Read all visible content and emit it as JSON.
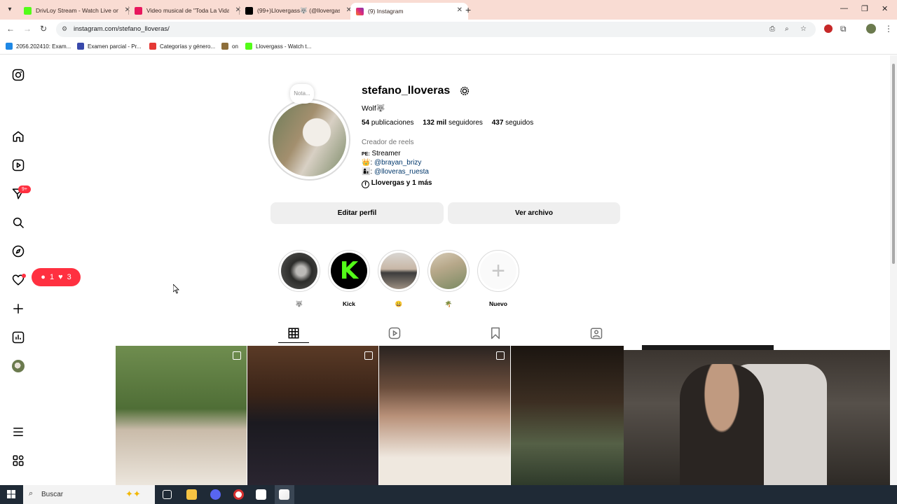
{
  "browser": {
    "tabs": [
      {
        "label": "DrivLoy Stream - Watch Live on",
        "favicon_color": "#53fc18"
      },
      {
        "label": "Video musical de \"Toda La Vida",
        "favicon_color": "#e8175d"
      },
      {
        "label": "(99+)Llovergass🐺 (@llovergass",
        "favicon_color": "#000000"
      },
      {
        "label": "(9) Instagram",
        "favicon_color": "#e1306c"
      }
    ],
    "url": "instagram.com/stefano_lloveras/",
    "bookmarks": [
      {
        "label": "2056.202410: Exam...",
        "color": "#1e88e5"
      },
      {
        "label": "Examen parcial - Pr...",
        "color": "#3949ab"
      },
      {
        "label": "Categorías y género...",
        "color": "#e53935"
      },
      {
        "label": "on",
        "color": "#8d6e3a"
      },
      {
        "label": "Llovergass - Watch t...",
        "color": "#53fc18"
      }
    ]
  },
  "sidebar": {
    "notification_badge": "9+",
    "activity": {
      "comments": "1",
      "likes": "3"
    }
  },
  "profile": {
    "note": "Nota...",
    "username": "stefano_lloveras",
    "full_name": "Wolf🐺",
    "stats": {
      "posts_num": "54",
      "posts_label": "publicaciones",
      "followers_num": "132 mil",
      "followers_label": "seguidores",
      "following_num": "437",
      "following_label": "seguidos"
    },
    "category": "Creador de reels",
    "bio": {
      "line1_prefix": "PE:",
      "line1_text": "Streamer",
      "line2_emoji": "👑:",
      "line2_link": "@brayan_brizy",
      "line3_emoji": "👩‍👦:",
      "line3_link": "@lloveras_ruesta",
      "line4_text": "Llovergas y 1 más"
    },
    "buttons": {
      "edit": "Editar perfil",
      "archive": "Ver archivo"
    }
  },
  "highlights": [
    {
      "label": "🐺",
      "color": "#5a5a58"
    },
    {
      "label": "Kick",
      "color": "#53fc18"
    },
    {
      "label": "😀",
      "color": "#8c8a88"
    },
    {
      "label": "🌴",
      "color": "#b7a88a"
    },
    {
      "label": "Nuevo",
      "color": "#fafafa"
    }
  ],
  "taskbar": {
    "search_label": "Buscar"
  },
  "colors": {
    "accent_red": "#ff3040",
    "button_bg": "#efefef",
    "link": "#00376b"
  }
}
